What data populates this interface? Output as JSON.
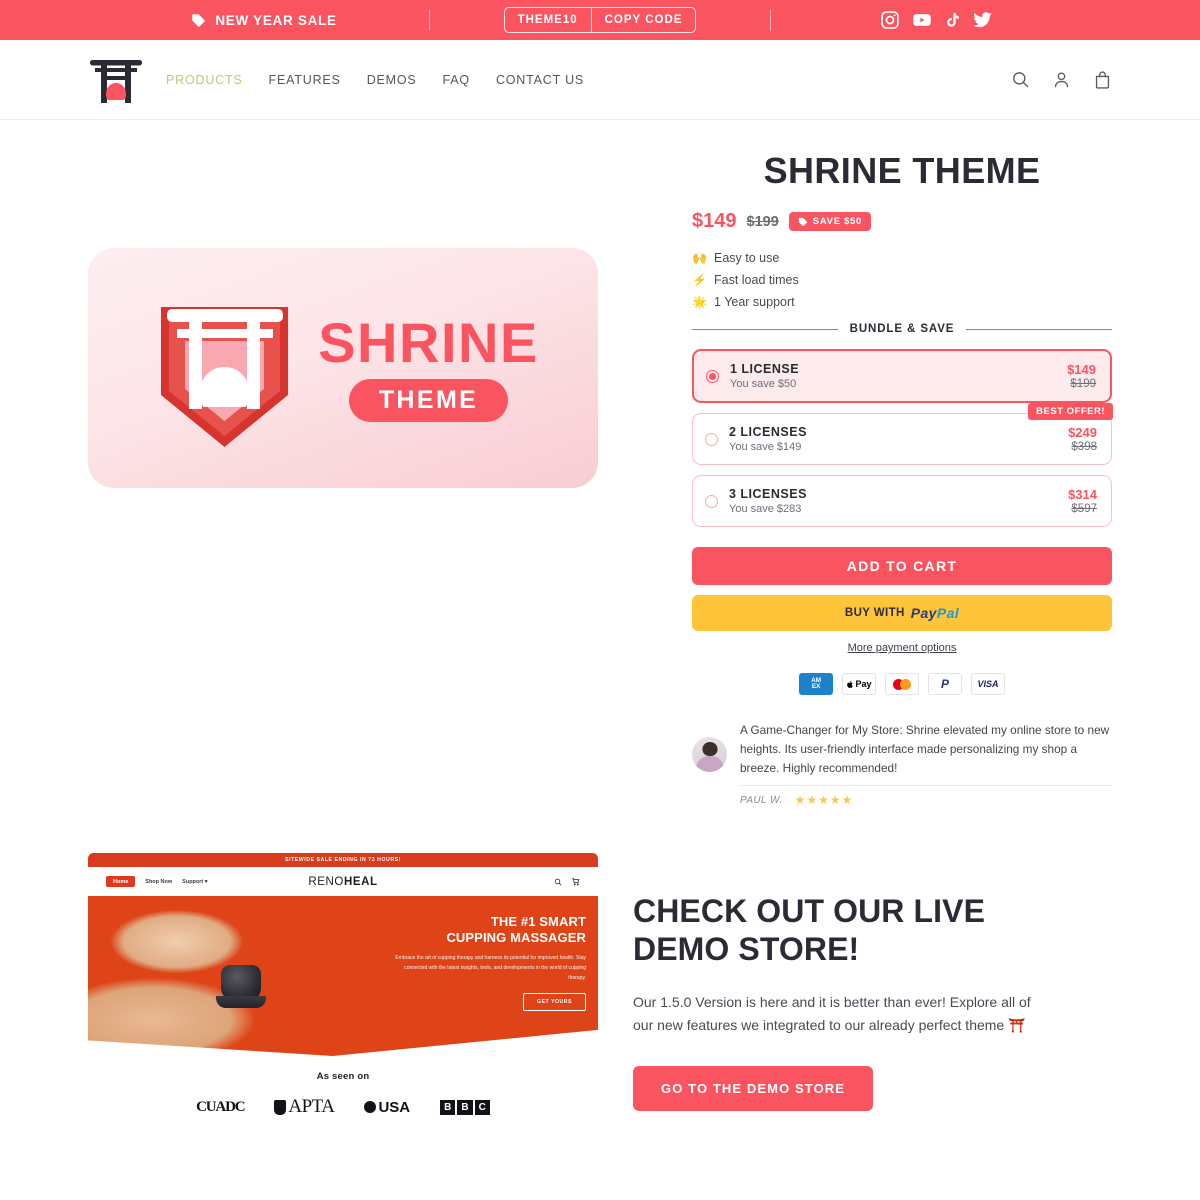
{
  "announcement": {
    "sale_label": "NEW YEAR SALE",
    "tag_icon": "tag-icon",
    "promo_code": "THEME10",
    "copy_button": "COPY CODE",
    "socials": [
      {
        "name": "instagram-icon"
      },
      {
        "name": "youtube-icon"
      },
      {
        "name": "tiktok-icon"
      },
      {
        "name": "twitter-icon"
      }
    ]
  },
  "header": {
    "logo_name": "torii-gate-logo",
    "nav": [
      {
        "label": "PRODUCTS",
        "active": true
      },
      {
        "label": "FEATURES",
        "active": false
      },
      {
        "label": "DEMOS",
        "active": false
      },
      {
        "label": "FAQ",
        "active": false
      },
      {
        "label": "CONTACT US",
        "active": false
      }
    ],
    "icons": [
      "search-icon",
      "account-icon",
      "cart-icon"
    ],
    "active_color": "#b4cf7c"
  },
  "product": {
    "image": {
      "brand_word": "SHRINE",
      "brand_pill": "THEME",
      "badge_name": "shrine-theme-logo"
    },
    "title": "SHRINE THEME",
    "price_current": "$149",
    "price_compare": "$199",
    "save_badge": "SAVE $50",
    "accent_color": "#FB5461",
    "bullets": [
      {
        "emoji": "🙌",
        "label": "Easy to use"
      },
      {
        "emoji": "⚡",
        "label": "Fast load times"
      },
      {
        "emoji": "🌟",
        "label": "1 Year support"
      }
    ],
    "bundle_heading": "BUNDLE & SAVE",
    "bundle_options": [
      {
        "name": "1 LICENSE",
        "save_text": "You save $50",
        "price": "$149",
        "compare": "$199",
        "selected": true,
        "badge": ""
      },
      {
        "name": "2 LICENSES",
        "save_text": "You save $149",
        "price": "$249",
        "compare": "$398",
        "selected": false,
        "badge": "BEST OFFER!"
      },
      {
        "name": "3 LICENSES",
        "save_text": "You save $283",
        "price": "$314",
        "compare": "$597",
        "selected": false,
        "badge": ""
      }
    ],
    "add_to_cart": "ADD TO CART",
    "paypal_prefix": "BUY WITH",
    "paypal_pay": "Pay",
    "paypal_pal": "Pal",
    "more_payment": "More payment options",
    "payment_icons": [
      {
        "name": "amex-icon",
        "line1": "AM",
        "line2": "EX"
      },
      {
        "name": "apple-pay-icon",
        "label": "Pay"
      },
      {
        "name": "mastercard-icon",
        "label": ""
      },
      {
        "name": "paypal-icon",
        "label": "P"
      },
      {
        "name": "visa-icon",
        "label": "VISA"
      }
    ]
  },
  "testimonial": {
    "text": "A Game-Changer for My Store: Shrine elevated my online store to new heights. Its user-friendly interface made personalizing my shop a breeze. Highly recommended!",
    "author": "PAUL W.",
    "stars": "★★★★★",
    "star_color": "#FFC83D"
  },
  "demo": {
    "screenshot": {
      "announce": "SITEWIDE SALE ENDING IN 72 HOURS!",
      "nav": [
        {
          "label": "Home",
          "active": true
        },
        {
          "label": "Shop Now",
          "active": false
        },
        {
          "label": "Support ▾",
          "active": false
        }
      ],
      "brand_light": "RENO",
      "brand_bold": "HEAL",
      "hero_title_line1": "THE #1 SMART",
      "hero_title_line2": "CUPPING MASSAGER",
      "hero_paragraph": "Embrace the art of cupping therapy and harness its potential for improved health. Stay connected with the latest insights, tools, and developments in the world of cupping therapy.",
      "hero_button": "GET YOURS",
      "seen_on_title": "As seen on",
      "logos": [
        "CUADC",
        "APTA",
        "USA",
        "BBC"
      ],
      "icons": [
        "search-icon",
        "cart-icon"
      ]
    },
    "title_line1": "CHECK OUT OUR LIVE",
    "title_line2": "DEMO STORE!",
    "description": "Our 1.5.0 Version is here and it is better than ever! Explore all of our new features we integrated to our already perfect theme ⛩️",
    "button": "GO TO THE DEMO STORE"
  }
}
